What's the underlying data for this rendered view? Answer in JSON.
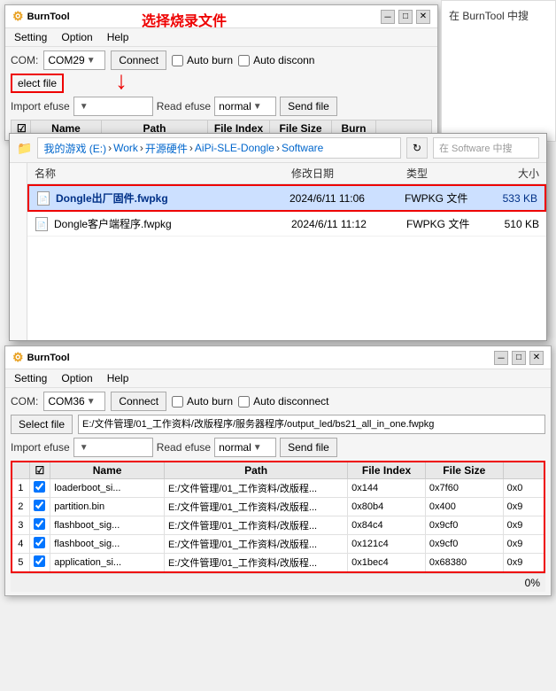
{
  "top_window": {
    "title": "BurnTool",
    "menu": [
      "Setting",
      "Option",
      "Help"
    ],
    "com_label": "COM:",
    "com_value": "COM29",
    "connect_btn": "Connect",
    "auto_burn": "Auto burn",
    "auto_disconnect": "Auto disconn",
    "select_file_btn": "elect file",
    "import_label": "Import efuse",
    "read_label": "Read efuse",
    "read_value": "normal",
    "send_file_btn": "Send file",
    "table_headers": [
      "",
      "Name",
      "Path",
      "File Index",
      "File Size",
      "Burn"
    ],
    "overlay_text": "在 BurnTool 中搜",
    "top_title": "选择烧录文件"
  },
  "file_dialog": {
    "nav_items": [
      "我的游戏 (E:)",
      "Work",
      "开源硬件",
      "AiPi-SLE-Dongle",
      "Software"
    ],
    "search_placeholder": "在 Software 中搜",
    "refresh_icon": "↻",
    "column_headers": {
      "name": "名称",
      "modified": "修改日期",
      "type": "类型",
      "size": "大小"
    },
    "files": [
      {
        "name": "Dongle出厂固件.fwpkg",
        "modified": "2024/6/11 11:06",
        "type": "FWPKG 文件",
        "size": "533 KB",
        "selected": true
      },
      {
        "name": "Dongle客户端程序.fwpkg",
        "modified": "2024/6/11 11:12",
        "type": "FWPKG 文件",
        "size": "510 KB",
        "selected": false
      }
    ]
  },
  "bottom_window": {
    "title": "BurnTool",
    "menu": [
      "Setting",
      "Option",
      "Help"
    ],
    "com_label": "COM:",
    "com_value": "COM36",
    "connect_btn": "Connect",
    "auto_burn": "Auto burn",
    "auto_disconnect": "Auto disconnect",
    "select_file_btn": "Select file",
    "file_path": "E:/文件管理/01_工作资料/改版程序/服务器程序/output_led/bs21_all_in_one.fwpkg",
    "import_label": "Import efuse",
    "read_label": "Read efuse",
    "read_value": "normal",
    "send_file_btn": "Send file",
    "table_headers": [
      "",
      "",
      "Name",
      "Path",
      "File Index",
      "File Size",
      ""
    ],
    "rows": [
      {
        "num": "1",
        "checked": true,
        "name": "loaderboot_si...",
        "path": "E:/文件管理/01_工作资料/改版程...",
        "file_index": "0x144",
        "file_size": "0x7f60",
        "extra": "0x0"
      },
      {
        "num": "2",
        "checked": true,
        "name": "partition.bin",
        "path": "E:/文件管理/01_工作资料/改版程...",
        "file_index": "0x80b4",
        "file_size": "0x400",
        "extra": "0x9"
      },
      {
        "num": "3",
        "checked": true,
        "name": "flashboot_sig...",
        "path": "E:/文件管理/01_工作资料/改版程...",
        "file_index": "0x84c4",
        "file_size": "0x9cf0",
        "extra": "0x9"
      },
      {
        "num": "4",
        "checked": true,
        "name": "flashboot_sig...",
        "path": "E:/文件管理/01_工作资料/改版程...",
        "file_index": "0x121c4",
        "file_size": "0x9cf0",
        "extra": "0x9"
      },
      {
        "num": "5",
        "checked": true,
        "name": "application_si...",
        "path": "E:/文件管理/01_工作资料/改版程...",
        "file_index": "0x1bec4",
        "file_size": "0x68380",
        "extra": "0x9"
      }
    ],
    "progress": "0%"
  },
  "arrow": "↓",
  "red_label": "选择烧录文件"
}
